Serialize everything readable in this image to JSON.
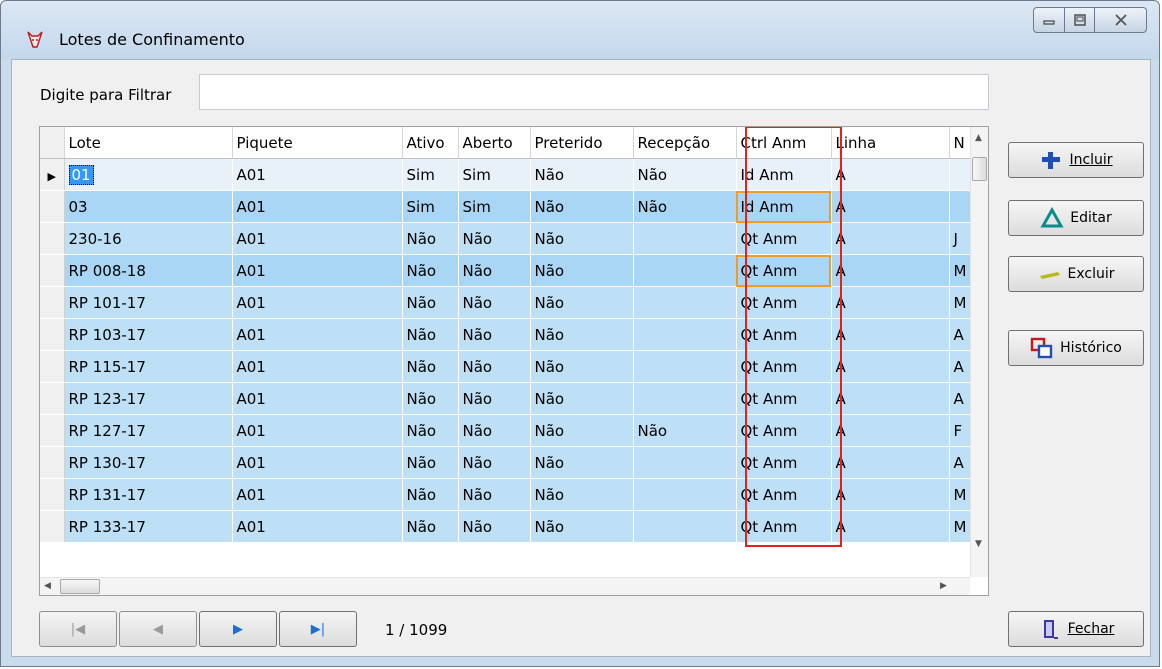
{
  "window": {
    "title": "Lotes de Confinamento",
    "app_icon": "cow-icon",
    "controls": [
      "minimize-icon",
      "maximize-icon",
      "close-icon"
    ]
  },
  "filter": {
    "label": "Digite para Filtrar",
    "value": "",
    "placeholder": ""
  },
  "grid": {
    "columns": [
      "Lote",
      "Piquete",
      "Ativo",
      "Aberto",
      "Preterido",
      "Recepção",
      "Ctrl Anm",
      "Linha",
      "N"
    ],
    "rows": [
      [
        "01",
        "A01",
        "Sim",
        "Sim",
        "Não",
        "Não",
        "Id Anm",
        "A",
        ""
      ],
      [
        "03",
        "A01",
        "Sim",
        "Sim",
        "Não",
        "Não",
        "Id Anm",
        "A",
        ""
      ],
      [
        "230-16",
        "A01",
        "Não",
        "Não",
        "Não",
        "",
        "Qt Anm",
        "A",
        "J"
      ],
      [
        "RP 008-18",
        "A01",
        "Não",
        "Não",
        "Não",
        "",
        "Qt Anm",
        "A",
        "M"
      ],
      [
        "RP 101-17",
        "A01",
        "Não",
        "Não",
        "Não",
        "",
        "Qt Anm",
        "A",
        "M"
      ],
      [
        "RP 103-17",
        "A01",
        "Não",
        "Não",
        "Não",
        "",
        "Qt Anm",
        "A",
        "A"
      ],
      [
        "RP 115-17",
        "A01",
        "Não",
        "Não",
        "Não",
        "",
        "Qt Anm",
        "A",
        "A"
      ],
      [
        "RP 123-17",
        "A01",
        "Não",
        "Não",
        "Não",
        "",
        "Qt Anm",
        "A",
        "A"
      ],
      [
        "RP 127-17",
        "A01",
        "Não",
        "Não",
        "Não",
        "Não",
        "Qt Anm",
        "A",
        "F"
      ],
      [
        "RP 130-17",
        "A01",
        "Não",
        "Não",
        "Não",
        "",
        "Qt Anm",
        "A",
        "A"
      ],
      [
        "RP 131-17",
        "A01",
        "Não",
        "Não",
        "Não",
        "",
        "Qt Anm",
        "A",
        "M"
      ],
      [
        "RP 133-17",
        "A01",
        "Não",
        "Não",
        "Não",
        "",
        "Qt Anm",
        "A",
        "M"
      ]
    ]
  },
  "buttons": {
    "incluir": {
      "label": "Incluir",
      "icon": "plus-icon"
    },
    "editar": {
      "label": "Editar",
      "icon": "triangle-icon"
    },
    "excluir": {
      "label": "Excluir",
      "icon": "minus-icon"
    },
    "historico": {
      "label": "Histórico",
      "icon": "history-icon"
    },
    "fechar": {
      "label": "Fechar",
      "icon": "door-exit-icon"
    }
  },
  "navigation": {
    "position": "1 / 1099"
  },
  "colors": {
    "row_fill": "#bde0f6",
    "current_cell": "#3399ff",
    "highlight_column": "#e2231a",
    "highlight_cell": "#f59a23"
  }
}
